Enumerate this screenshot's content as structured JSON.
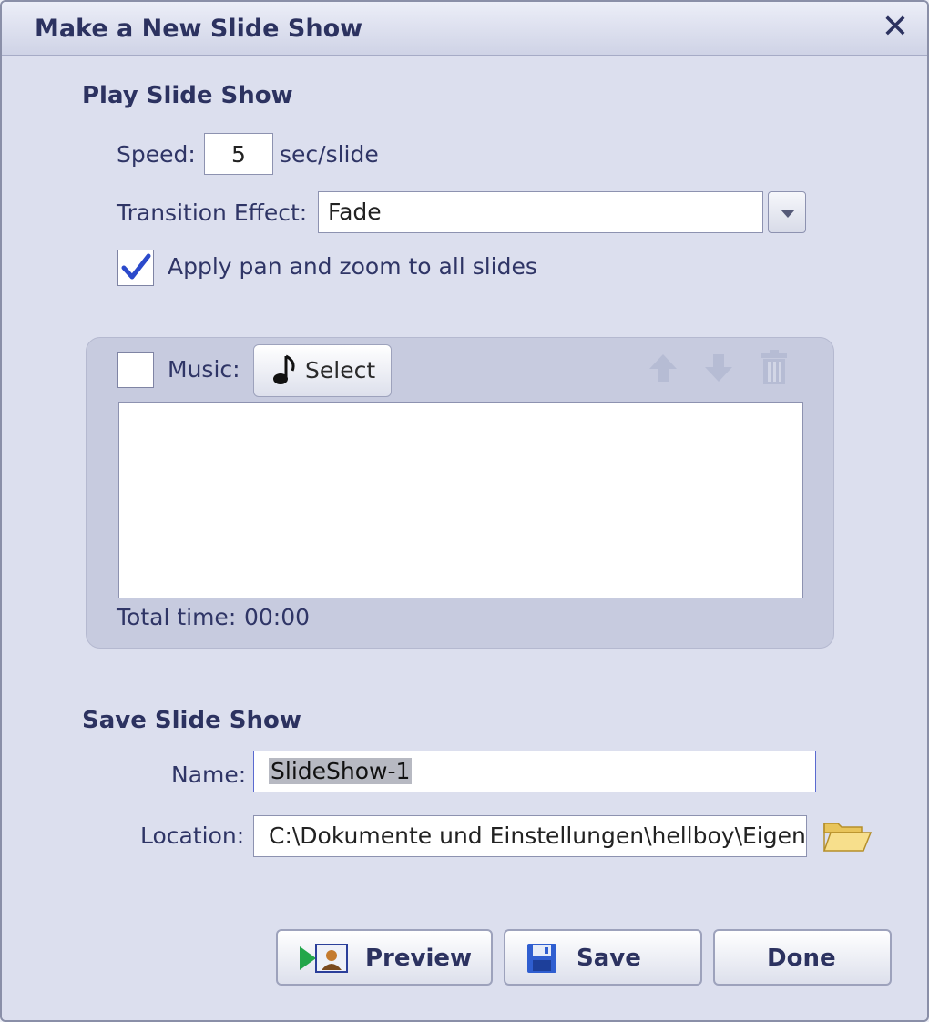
{
  "window": {
    "title": "Make a New Slide Show",
    "close_glyph": "✕"
  },
  "play": {
    "heading": "Play Slide Show",
    "speed_label": "Speed:",
    "speed_value": "5",
    "speed_unit": "sec/slide",
    "transition_label": "Transition Effect:",
    "transition_value": "Fade",
    "panzoom_label": "Apply pan and zoom to all slides",
    "panzoom_checked": true
  },
  "music": {
    "checked": false,
    "label": "Music:",
    "select_label": "Select",
    "total_time_label": "Total time:",
    "total_time_value": "00:00",
    "icons": [
      "arrow-up-icon",
      "arrow-down-icon",
      "trash-icon"
    ]
  },
  "save": {
    "heading": "Save Slide Show",
    "name_label": "Name:",
    "name_value": "SlideShow-1",
    "location_label": "Location:",
    "location_value": "C:\\Dokumente und Einstellungen\\hellboy\\Eigene"
  },
  "buttons": {
    "preview": "Preview",
    "save": "Save",
    "done": "Done"
  },
  "colors": {
    "dialog_bg": "#dcdfee",
    "panel_bg": "#c7cbdf",
    "heading_text": "#2c3260",
    "check_blue": "#2b4acb"
  }
}
